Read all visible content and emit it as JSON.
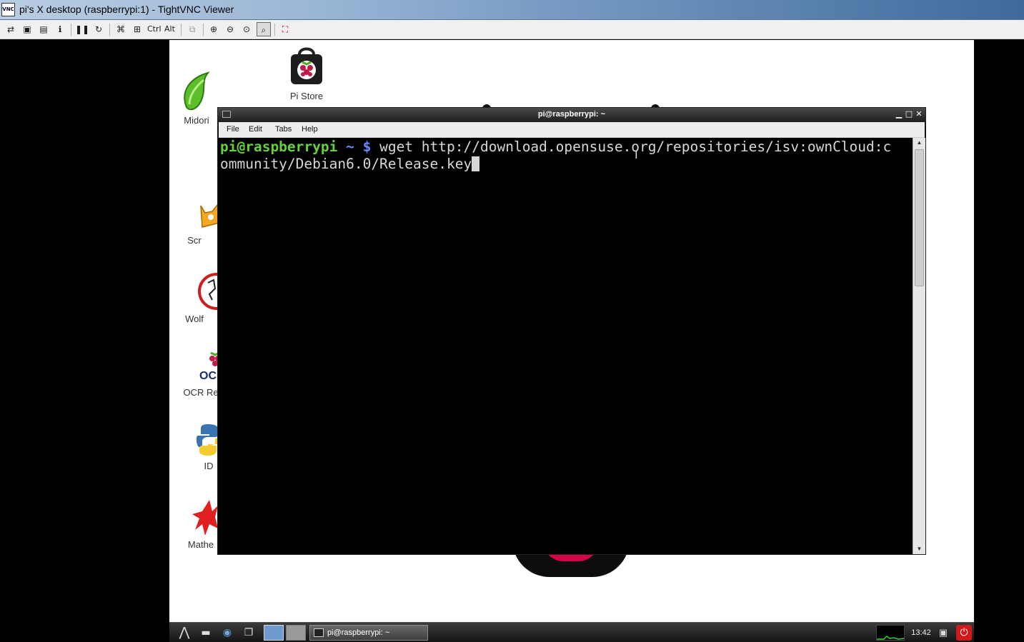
{
  "viewer": {
    "title": "pi's X desktop (raspberrypi:1) - TightVNC Viewer",
    "icon_label": "VNC",
    "toolbar": {
      "ctrl_label": "Ctrl",
      "alt_label": "Alt",
      "icons": [
        "new-connection-icon",
        "save-icon",
        "options-icon",
        "info-icon",
        "pause-icon",
        "refresh-icon",
        "ctrl-alt-del-icon",
        "ctrl-esc-icon",
        "clipboard-icon",
        "zoom-in-icon",
        "zoom-out-icon",
        "zoom-100-icon",
        "zoom-fit-icon",
        "fullscreen-icon"
      ]
    }
  },
  "desktop": {
    "icons": [
      {
        "name": "Midori"
      },
      {
        "name": "Pi Store"
      },
      {
        "name": "Scr"
      },
      {
        "name": "Wolf"
      },
      {
        "name": "OCR Re"
      },
      {
        "name": "ID"
      },
      {
        "name": "Mathe"
      }
    ],
    "ocr_logo_text": "OC"
  },
  "terminal": {
    "title": "pi@raspberrypi: ~",
    "menu": [
      "File",
      "Edit",
      "Tabs",
      "Help"
    ],
    "prompt_user": "pi@raspberrypi",
    "prompt_path": "~ $",
    "command_line1": "wget http://download.opensuse.org/repositories/isv:ownCloud:c",
    "command_line2": "ommunity/Debian6.0/Release.key"
  },
  "taskbar": {
    "task_label": "pi@raspberrypi: ~",
    "clock": "13:42"
  },
  "colors": {
    "prompt_user": "#65d13a",
    "prompt_path": "#6b86ff",
    "terminal_bg": "#000000"
  }
}
